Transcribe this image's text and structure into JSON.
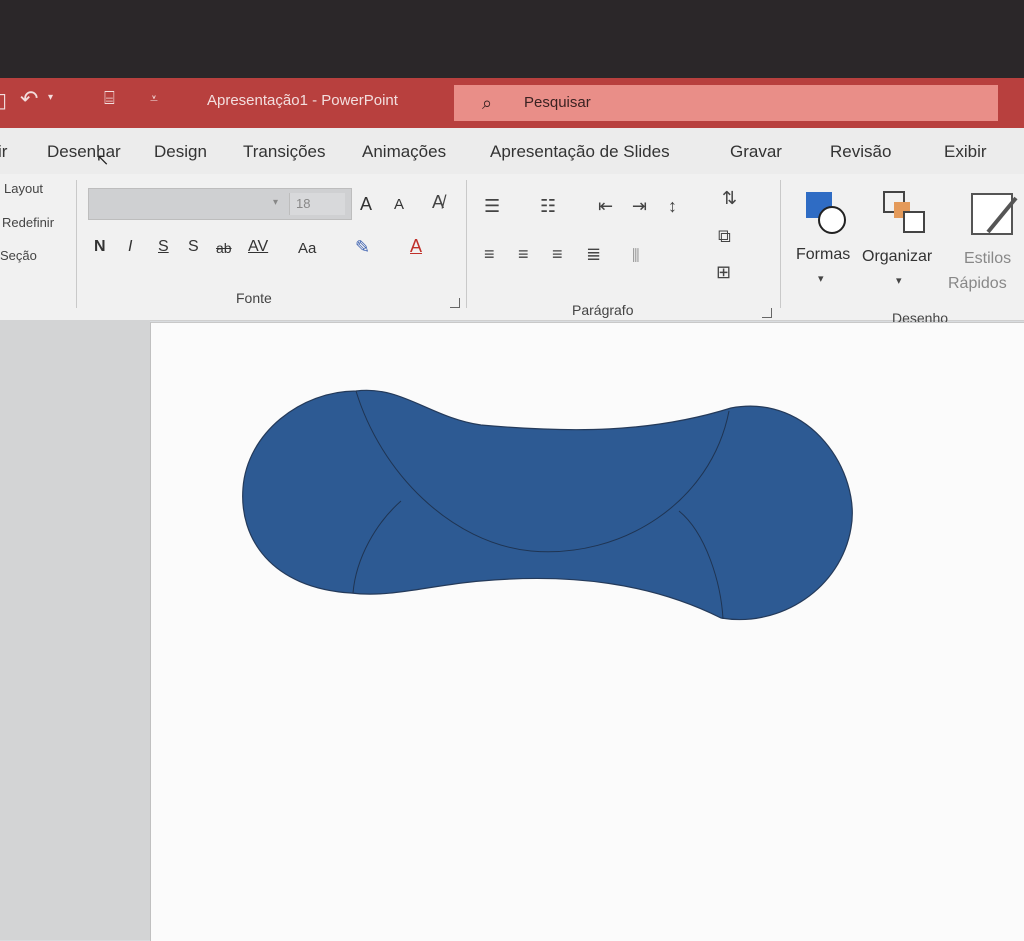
{
  "window": {
    "title": "Apresentação1 - PowerPoint",
    "search_placeholder": "Pesquisar"
  },
  "tabs": [
    "ir",
    "Desenhar",
    "Design",
    "Transições",
    "Animações",
    "Apresentação de Slides",
    "Gravar",
    "Revisão",
    "Exibir"
  ],
  "ribbon": {
    "slides_group": {
      "layout": "Layout",
      "redefinir": "Redefinir",
      "secao": "Seção"
    },
    "fonte": {
      "label": "Fonte",
      "font_size": "18",
      "bold": "N",
      "italic": "I",
      "underline": "S",
      "shadow": "S",
      "strike": "ab",
      "spacing": "AV",
      "case": "Aa",
      "grow": "A",
      "shrink": "A"
    },
    "paragrafo": {
      "label": "Parágrafo"
    },
    "desenho": {
      "label": "Desenho",
      "formas": "Formas",
      "organizar": "Organizar",
      "estilos": "Estilos",
      "rapidos": "Rápidos"
    }
  },
  "slide": {
    "shape_color": "#2d5a93",
    "shape_stroke": "#243a5a"
  },
  "colors": {
    "titlebar": "#b8403e",
    "search": "#e98e88",
    "ribbon": "#f1f1f1"
  }
}
